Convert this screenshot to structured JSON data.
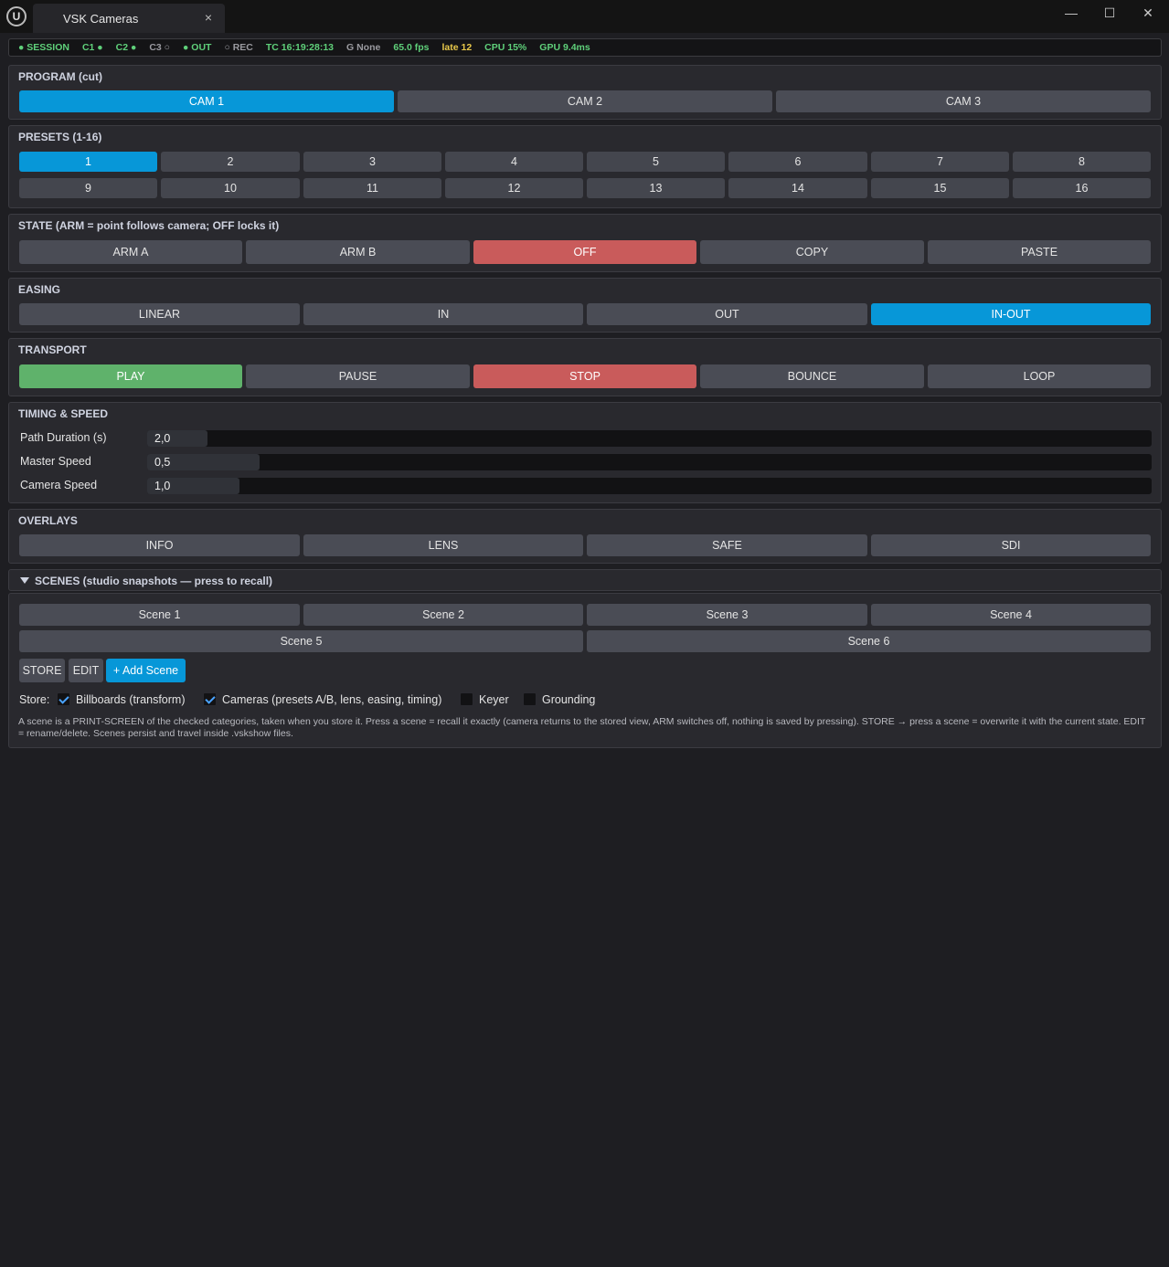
{
  "window": {
    "app_logo": "U",
    "tab_title": "VSK Cameras",
    "tab_close_glyph": "×",
    "minimize_glyph": "—",
    "maximize_glyph": "☐",
    "close_glyph": "✕"
  },
  "status": {
    "items": [
      {
        "text": "● SESSION",
        "color": "#5fd07a"
      },
      {
        "text": "C1 ●",
        "color": "#5fd07a"
      },
      {
        "text": "C2 ●",
        "color": "#5fd07a"
      },
      {
        "text": "C3 ○",
        "color": "#9a9aa0"
      },
      {
        "text": "● OUT",
        "color": "#5fd07a"
      },
      {
        "text": "○ REC",
        "color": "#9a9aa0"
      },
      {
        "text": "TC 16:19:28:13",
        "color": "#5fd07a"
      },
      {
        "text": "G None",
        "color": "#9a9aa0"
      },
      {
        "text": "65.0 fps",
        "color": "#5fd07a"
      },
      {
        "text": "late 12",
        "color": "#e8c84a"
      },
      {
        "text": "CPU 15%",
        "color": "#5fd07a"
      },
      {
        "text": "GPU 9.4ms",
        "color": "#5fd07a"
      }
    ]
  },
  "program": {
    "title": "PROGRAM  (cut)",
    "buttons": [
      "CAM 1",
      "CAM 2",
      "CAM 3"
    ],
    "active": "CAM 1"
  },
  "presets": {
    "title": "PRESETS  (1-16)",
    "buttons": [
      "1",
      "2",
      "3",
      "4",
      "5",
      "6",
      "7",
      "8",
      "9",
      "10",
      "11",
      "12",
      "13",
      "14",
      "15",
      "16"
    ],
    "active": "1"
  },
  "state": {
    "title": "STATE  (ARM = point follows camera; OFF locks it)",
    "buttons": [
      "ARM A",
      "ARM B",
      "OFF",
      "COPY",
      "PASTE"
    ],
    "active": "OFF"
  },
  "easing": {
    "title": "EASING",
    "buttons": [
      "LINEAR",
      "IN",
      "OUT",
      "IN-OUT"
    ],
    "active": "IN-OUT"
  },
  "transport": {
    "title": "TRANSPORT",
    "buttons": [
      "PLAY",
      "PAUSE",
      "STOP",
      "BOUNCE",
      "LOOP"
    ],
    "active_play": "PLAY",
    "active_stop": "STOP"
  },
  "timing": {
    "title": "TIMING & SPEED",
    "sliders": [
      {
        "label": "Path Duration (s)",
        "value": "2,0",
        "fraction": 0.06
      },
      {
        "label": "Master Speed",
        "value": "0,5",
        "fraction": 0.112
      },
      {
        "label": "Camera Speed",
        "value": "1,0",
        "fraction": 0.092
      }
    ]
  },
  "overlays": {
    "title": "OVERLAYS",
    "buttons": [
      "INFO",
      "LENS",
      "SAFE",
      "SDI"
    ]
  },
  "scenes": {
    "title": "SCENES  (studio snapshots — press to recall)",
    "scene_buttons": [
      "Scene 1",
      "Scene 2",
      "Scene 3",
      "Scene 4",
      "Scene 5",
      "Scene 6"
    ],
    "store_label": "STORE",
    "edit_label": "EDIT",
    "add_label": "+ Add Scene",
    "store_prefix": "Store:",
    "checks": [
      {
        "label": "Billboards (transform)",
        "checked": true
      },
      {
        "label": "Cameras (presets A/B, lens, easing, timing)",
        "checked": true
      },
      {
        "label": "Keyer",
        "checked": false
      },
      {
        "label": "Grounding",
        "checked": false
      }
    ],
    "info": "A scene is a PRINT-SCREEN of the checked categories, taken when you store it. Press a scene = recall it exactly (camera returns to the stored view, ARM switches off, nothing is saved by pressing). STORE → press a scene = overwrite it with the current state. EDIT = rename/delete. Scenes persist and travel inside .vskshow files."
  }
}
